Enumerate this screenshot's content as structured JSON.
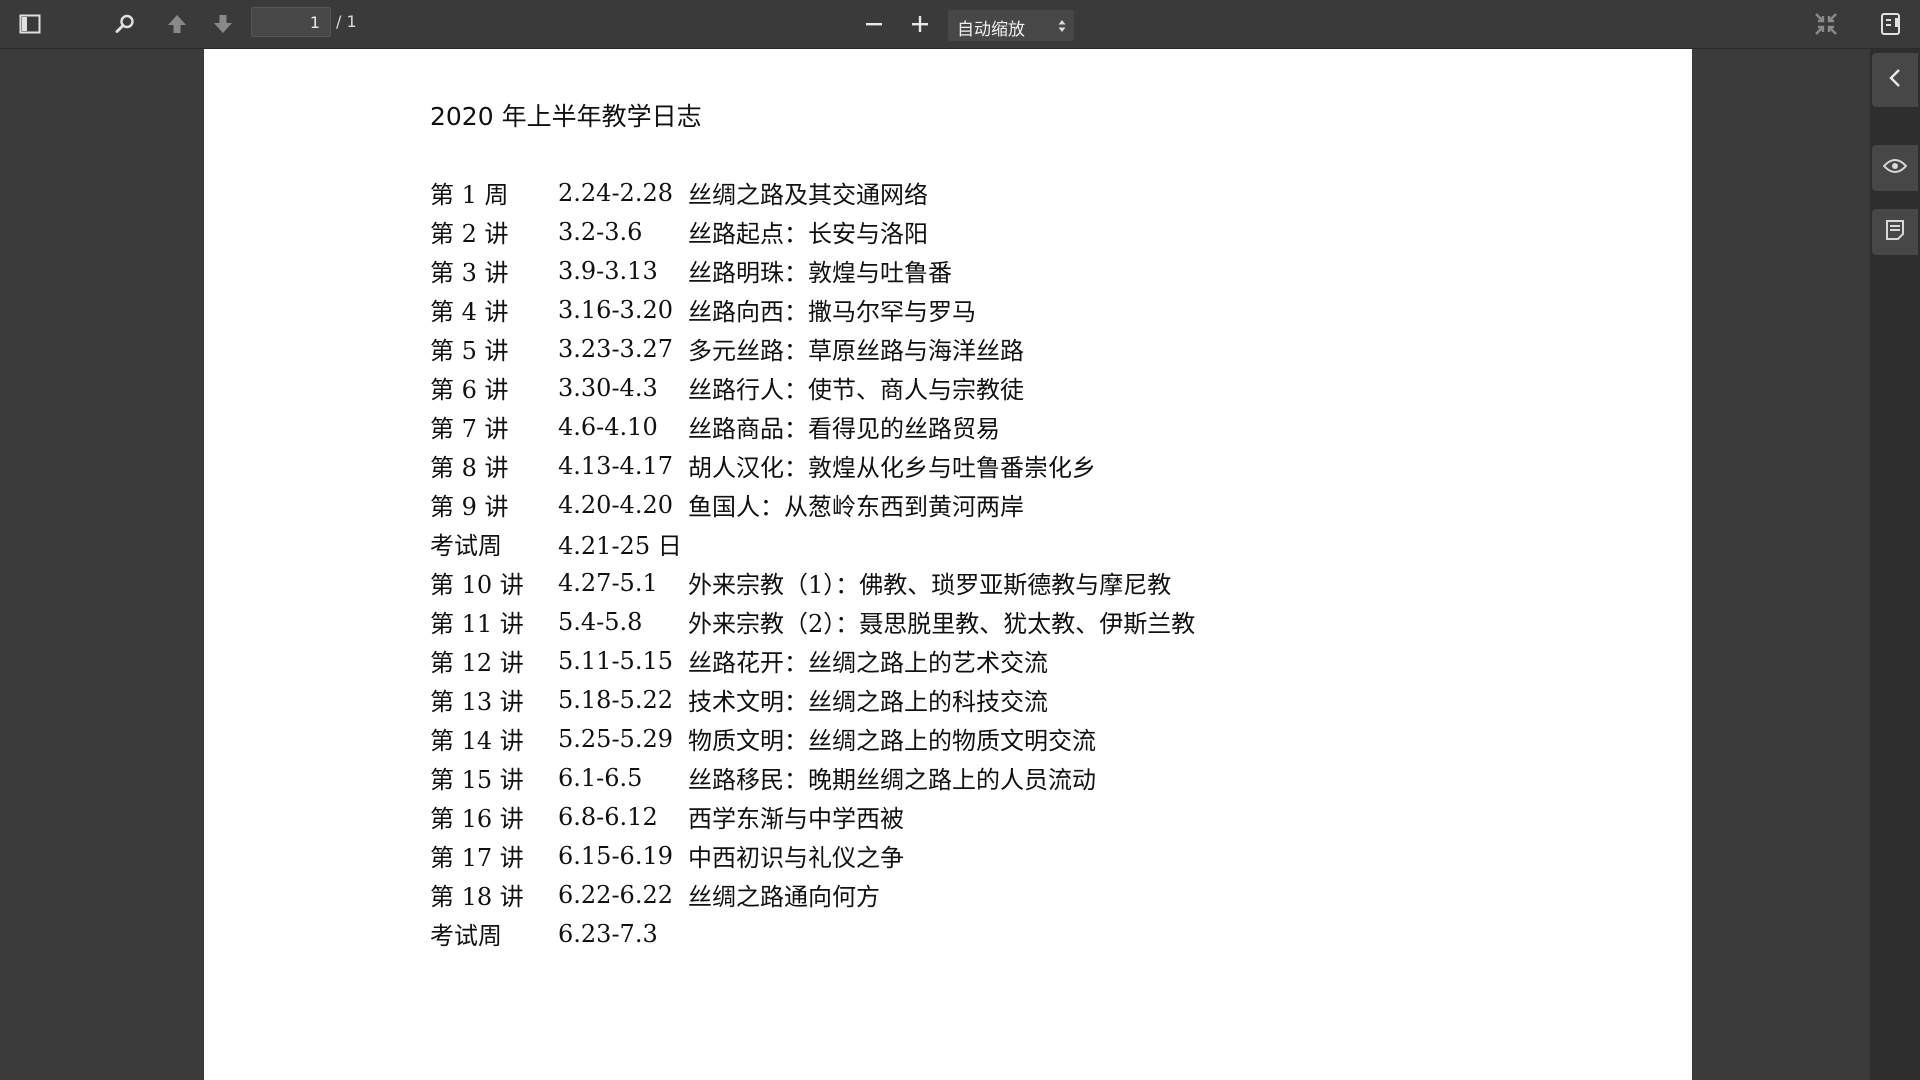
{
  "toolbar": {
    "page_value": "1",
    "page_count": "/ 1",
    "zoom_label": "自动缩放"
  },
  "document": {
    "title": "2020 年上半年教学日志",
    "rows": [
      {
        "label": "第 1 周",
        "date": "2.24-2.28",
        "topic": "丝绸之路及其交通网络"
      },
      {
        "label": "第 2 讲",
        "date": "3.2-3.6",
        "topic": "丝路起点：长安与洛阳"
      },
      {
        "label": "第 3 讲",
        "date": "3.9-3.13",
        "topic": "丝路明珠：敦煌与吐鲁番"
      },
      {
        "label": "第 4 讲",
        "date": "3.16-3.20",
        "topic": "丝路向西：撒马尔罕与罗马"
      },
      {
        "label": "第 5 讲",
        "date": "3.23-3.27",
        "topic": "多元丝路：草原丝路与海洋丝路"
      },
      {
        "label": "第 6 讲",
        "date": "3.30-4.3",
        "topic": "丝路行人：使节、商人与宗教徒"
      },
      {
        "label": "第 7 讲",
        "date": "4.6-4.10",
        "topic": "丝路商品：看得见的丝路贸易"
      },
      {
        "label": "第 8 讲",
        "date": "4.13-4.17",
        "topic": "胡人汉化：敦煌从化乡与吐鲁番崇化乡"
      },
      {
        "label": "第 9 讲",
        "date": "4.20-4.20",
        "topic": "鱼国人：从葱岭东西到黄河两岸"
      },
      {
        "label": "考试周",
        "date": "4.21-25 日",
        "topic": ""
      },
      {
        "label": "第 10 讲",
        "date": "4.27-5.1",
        "topic": "外来宗教（1）：佛教、琐罗亚斯德教与摩尼教"
      },
      {
        "label": "第 11 讲",
        "date": "5.4-5.8",
        "topic": "外来宗教（2）：聂思脱里教、犹太教、伊斯兰教"
      },
      {
        "label": "第 12 讲",
        "date": "5.11-5.15",
        "topic": "丝路花开：丝绸之路上的艺术交流"
      },
      {
        "label": "第 13 讲",
        "date": "5.18-5.22",
        "topic": "技术文明：丝绸之路上的科技交流"
      },
      {
        "label": "第 14 讲",
        "date": "5.25-5.29",
        "topic": "物质文明：丝绸之路上的物质文明交流"
      },
      {
        "label": "第 15 讲",
        "date": "6.1-6.5",
        "topic": "丝路移民：晚期丝绸之路上的人员流动"
      },
      {
        "label": "第 16 讲",
        "date": "6.8-6.12",
        "topic": "西学东渐与中学西被"
      },
      {
        "label": "第 17 讲",
        "date": "6.15-6.19",
        "topic": "中西初识与礼仪之争"
      },
      {
        "label": "第 18 讲",
        "date": "6.22-6.22",
        "topic": "丝绸之路通向何方"
      },
      {
        "label": "考试周",
        "date": "6.23-7.3",
        "topic": ""
      }
    ]
  },
  "icons": {
    "toolbar": [
      "sidebar-toggle-icon",
      "search-icon",
      "arrow-up-icon",
      "arrow-down-icon",
      "minus-icon",
      "plus-icon",
      "collapse-icon",
      "bookmark-icon"
    ],
    "sidebar": [
      "chevron-left-icon",
      "eye-icon",
      "notes-icon"
    ]
  },
  "colors": {
    "toolbar_bg": "#3a3a3a",
    "canvas_bg": "#3b3b3b",
    "sidebar_bg": "#2e2e2e",
    "page_bg": "#ffffff",
    "text": "#111111"
  }
}
